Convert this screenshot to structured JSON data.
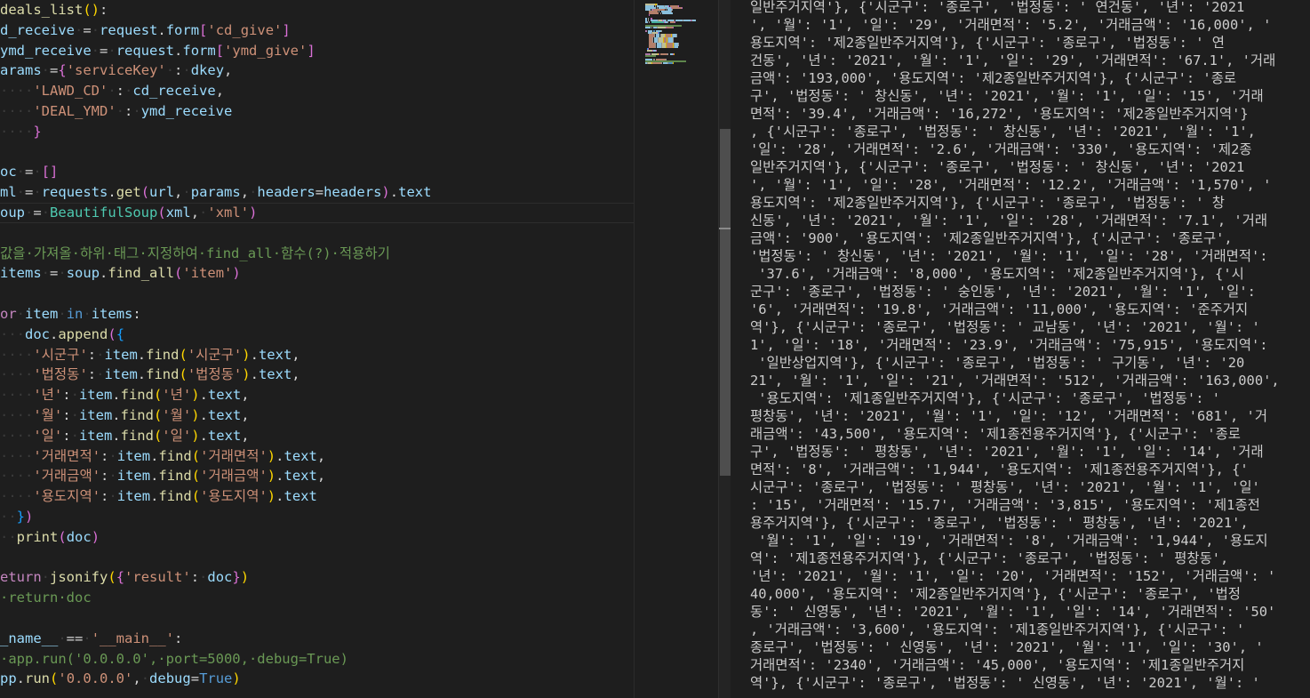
{
  "editor": {
    "lines": [
      [
        [
          "fn",
          "deals_list"
        ],
        [
          "br1",
          "("
        ],
        [
          "br1",
          ")"
        ],
        [
          "p",
          ":"
        ]
      ],
      [
        [
          "var",
          "d_receive"
        ],
        [
          "ws",
          "·"
        ],
        [
          "op",
          "="
        ],
        [
          "ws",
          "·"
        ],
        [
          "var",
          "request"
        ],
        [
          "p",
          "."
        ],
        [
          "var",
          "form"
        ],
        [
          "br2",
          "["
        ],
        [
          "str",
          "'cd_give'"
        ],
        [
          "br2",
          "]"
        ]
      ],
      [
        [
          "var",
          "ymd_receive"
        ],
        [
          "ws",
          "·"
        ],
        [
          "op",
          "="
        ],
        [
          "ws",
          "·"
        ],
        [
          "var",
          "request"
        ],
        [
          "p",
          "."
        ],
        [
          "var",
          "form"
        ],
        [
          "br2",
          "["
        ],
        [
          "str",
          "'ymd_give'"
        ],
        [
          "br2",
          "]"
        ]
      ],
      [
        [
          "var",
          "arams"
        ],
        [
          "ws",
          "·"
        ],
        [
          "op",
          "="
        ],
        [
          "br2",
          "{"
        ],
        [
          "str",
          "'serviceKey'"
        ],
        [
          "ws",
          "·"
        ],
        [
          "p",
          ":"
        ],
        [
          "ws",
          "·"
        ],
        [
          "var",
          "dkey"
        ],
        [
          "p",
          ","
        ]
      ],
      [
        [
          "ws",
          "····"
        ],
        [
          "str",
          "'LAWD_CD'"
        ],
        [
          "ws",
          "·"
        ],
        [
          "p",
          ":"
        ],
        [
          "ws",
          "·"
        ],
        [
          "var",
          "cd_receive"
        ],
        [
          "p",
          ","
        ]
      ],
      [
        [
          "ws",
          "····"
        ],
        [
          "str",
          "'DEAL_YMD'"
        ],
        [
          "ws",
          "·"
        ],
        [
          "p",
          ":"
        ],
        [
          "ws",
          "·"
        ],
        [
          "var",
          "ymd_receive"
        ]
      ],
      [
        [
          "ws",
          "····"
        ],
        [
          "br2",
          "}"
        ]
      ],
      [],
      [
        [
          "var",
          "oc"
        ],
        [
          "ws",
          "·"
        ],
        [
          "op",
          "="
        ],
        [
          "ws",
          "·"
        ],
        [
          "br2",
          "["
        ],
        [
          "br2",
          "]"
        ]
      ],
      [
        [
          "var",
          "ml"
        ],
        [
          "ws",
          "·"
        ],
        [
          "op",
          "="
        ],
        [
          "ws",
          "·"
        ],
        [
          "var",
          "requests"
        ],
        [
          "p",
          "."
        ],
        [
          "fn",
          "get"
        ],
        [
          "br2",
          "("
        ],
        [
          "var",
          "url"
        ],
        [
          "p",
          ","
        ],
        [
          "ws",
          "·"
        ],
        [
          "var",
          "params"
        ],
        [
          "p",
          ","
        ],
        [
          "ws",
          "·"
        ],
        [
          "var",
          "headers"
        ],
        [
          "op",
          "="
        ],
        [
          "var",
          "headers"
        ],
        [
          "br2",
          ")"
        ],
        [
          "p",
          "."
        ],
        [
          "var",
          "text"
        ]
      ],
      [
        [
          "var",
          "oup"
        ],
        [
          "ws",
          "·"
        ],
        [
          "op",
          "="
        ],
        [
          "ws",
          "·"
        ],
        [
          "cls",
          "BeautifulSoup"
        ],
        [
          "br2",
          "("
        ],
        [
          "var",
          "xml"
        ],
        [
          "p",
          ","
        ],
        [
          "ws",
          "·"
        ],
        [
          "str",
          "'xml'"
        ],
        [
          "br2",
          ")"
        ]
      ],
      [],
      [
        [
          "com",
          "값을·가져올·하위·태그·지정하여·find_all·함수(?)·적용하기"
        ]
      ],
      [
        [
          "var",
          "items"
        ],
        [
          "ws",
          "·"
        ],
        [
          "op",
          "="
        ],
        [
          "ws",
          "·"
        ],
        [
          "var",
          "soup"
        ],
        [
          "p",
          "."
        ],
        [
          "fn",
          "find_all"
        ],
        [
          "br2",
          "("
        ],
        [
          "str",
          "'item'"
        ],
        [
          "br2",
          ")"
        ]
      ],
      [],
      [
        [
          "kw",
          "or"
        ],
        [
          "ws",
          "·"
        ],
        [
          "var",
          "item"
        ],
        [
          "ws",
          "·"
        ],
        [
          "kwb",
          "in"
        ],
        [
          "ws",
          "·"
        ],
        [
          "var",
          "items"
        ],
        [
          "p",
          ":"
        ]
      ],
      [
        [
          "ws",
          "···"
        ],
        [
          "var",
          "doc"
        ],
        [
          "p",
          "."
        ],
        [
          "fn",
          "append"
        ],
        [
          "br2",
          "("
        ],
        [
          "br3",
          "{"
        ]
      ],
      [
        [
          "ws",
          "····"
        ],
        [
          "str",
          "'시군구'"
        ],
        [
          "p",
          ":"
        ],
        [
          "ws",
          "·"
        ],
        [
          "var",
          "item"
        ],
        [
          "p",
          "."
        ],
        [
          "fn",
          "find"
        ],
        [
          "br1",
          "("
        ],
        [
          "str",
          "'시군구'"
        ],
        [
          "br1",
          ")"
        ],
        [
          "p",
          "."
        ],
        [
          "var",
          "text"
        ],
        [
          "p",
          ","
        ]
      ],
      [
        [
          "ws",
          "····"
        ],
        [
          "str",
          "'법정동'"
        ],
        [
          "p",
          ":"
        ],
        [
          "ws",
          "·"
        ],
        [
          "var",
          "item"
        ],
        [
          "p",
          "."
        ],
        [
          "fn",
          "find"
        ],
        [
          "br1",
          "("
        ],
        [
          "str",
          "'법정동'"
        ],
        [
          "br1",
          ")"
        ],
        [
          "p",
          "."
        ],
        [
          "var",
          "text"
        ],
        [
          "p",
          ","
        ]
      ],
      [
        [
          "ws",
          "····"
        ],
        [
          "str",
          "'년'"
        ],
        [
          "p",
          ":"
        ],
        [
          "ws",
          "·"
        ],
        [
          "var",
          "item"
        ],
        [
          "p",
          "."
        ],
        [
          "fn",
          "find"
        ],
        [
          "br1",
          "("
        ],
        [
          "str",
          "'년'"
        ],
        [
          "br1",
          ")"
        ],
        [
          "p",
          "."
        ],
        [
          "var",
          "text"
        ],
        [
          "p",
          ","
        ]
      ],
      [
        [
          "ws",
          "····"
        ],
        [
          "str",
          "'월'"
        ],
        [
          "p",
          ":"
        ],
        [
          "ws",
          "·"
        ],
        [
          "var",
          "item"
        ],
        [
          "p",
          "."
        ],
        [
          "fn",
          "find"
        ],
        [
          "br1",
          "("
        ],
        [
          "str",
          "'월'"
        ],
        [
          "br1",
          ")"
        ],
        [
          "p",
          "."
        ],
        [
          "var",
          "text"
        ],
        [
          "p",
          ","
        ]
      ],
      [
        [
          "ws",
          "····"
        ],
        [
          "str",
          "'일'"
        ],
        [
          "p",
          ":"
        ],
        [
          "ws",
          "·"
        ],
        [
          "var",
          "item"
        ],
        [
          "p",
          "."
        ],
        [
          "fn",
          "find"
        ],
        [
          "br1",
          "("
        ],
        [
          "str",
          "'일'"
        ],
        [
          "br1",
          ")"
        ],
        [
          "p",
          "."
        ],
        [
          "var",
          "text"
        ],
        [
          "p",
          ","
        ]
      ],
      [
        [
          "ws",
          "····"
        ],
        [
          "str",
          "'거래면적'"
        ],
        [
          "p",
          ":"
        ],
        [
          "ws",
          "·"
        ],
        [
          "var",
          "item"
        ],
        [
          "p",
          "."
        ],
        [
          "fn",
          "find"
        ],
        [
          "br1",
          "("
        ],
        [
          "str",
          "'거래면적'"
        ],
        [
          "br1",
          ")"
        ],
        [
          "p",
          "."
        ],
        [
          "var",
          "text"
        ],
        [
          "p",
          ","
        ]
      ],
      [
        [
          "ws",
          "····"
        ],
        [
          "str",
          "'거래금액'"
        ],
        [
          "p",
          ":"
        ],
        [
          "ws",
          "·"
        ],
        [
          "var",
          "item"
        ],
        [
          "p",
          "."
        ],
        [
          "fn",
          "find"
        ],
        [
          "br1",
          "("
        ],
        [
          "str",
          "'거래금액'"
        ],
        [
          "br1",
          ")"
        ],
        [
          "p",
          "."
        ],
        [
          "var",
          "text"
        ],
        [
          "p",
          ","
        ]
      ],
      [
        [
          "ws",
          "····"
        ],
        [
          "str",
          "'용도지역'"
        ],
        [
          "p",
          ":"
        ],
        [
          "ws",
          "·"
        ],
        [
          "var",
          "item"
        ],
        [
          "p",
          "."
        ],
        [
          "fn",
          "find"
        ],
        [
          "br1",
          "("
        ],
        [
          "str",
          "'용도지역'"
        ],
        [
          "br1",
          ")"
        ],
        [
          "p",
          "."
        ],
        [
          "var",
          "text"
        ]
      ],
      [
        [
          "ws",
          "··"
        ],
        [
          "br3",
          "}"
        ],
        [
          "br2",
          ")"
        ]
      ],
      [
        [
          "ws",
          "··"
        ],
        [
          "fn",
          "print"
        ],
        [
          "br2",
          "("
        ],
        [
          "var",
          "doc"
        ],
        [
          "br2",
          ")"
        ]
      ],
      [],
      [
        [
          "kw",
          "eturn"
        ],
        [
          "ws",
          "·"
        ],
        [
          "fn",
          "jsonify"
        ],
        [
          "br1",
          "("
        ],
        [
          "br2",
          "{"
        ],
        [
          "str",
          "'result'"
        ],
        [
          "p",
          ":"
        ],
        [
          "ws",
          "·"
        ],
        [
          "var",
          "doc"
        ],
        [
          "br2",
          "}"
        ],
        [
          "br1",
          ")"
        ]
      ],
      [
        [
          "com",
          "·return·doc"
        ]
      ],
      [],
      [
        [
          "var",
          "_name__"
        ],
        [
          "ws",
          "·"
        ],
        [
          "op",
          "=="
        ],
        [
          "ws",
          "·"
        ],
        [
          "str",
          "'__main__'"
        ],
        [
          "p",
          ":"
        ]
      ],
      [
        [
          "com",
          "·app.run('0.0.0.0',·port=5000,·debug=True)"
        ]
      ],
      [
        [
          "var",
          "pp"
        ],
        [
          "p",
          "."
        ],
        [
          "fn",
          "run"
        ],
        [
          "br1",
          "("
        ],
        [
          "str",
          "'0.0.0.0'"
        ],
        [
          "p",
          ","
        ],
        [
          "ws",
          "·"
        ],
        [
          "var",
          "debug"
        ],
        [
          "op",
          "="
        ],
        [
          "kwb",
          "True"
        ],
        [
          "br1",
          ")"
        ]
      ]
    ]
  },
  "output": {
    "lines": [
      "일반주거지역'}, {'시군구': '종로구', '법정동': ' 연건동', '년': '2021",
      "', '월': '1', '일': '29', '거래면적': '5.2', '거래금액': '16,000', '",
      "용도지역': '제2종일반주거지역'}, {'시군구': '종로구', '법정동': ' 연",
      "건동', '년': '2021', '월': '1', '일': '29', '거래면적': '67.1', '거래",
      "금액': '193,000', '용도지역': '제2종일반주거지역'}, {'시군구': '종로",
      "구', '법정동': ' 창신동', '년': '2021', '월': '1', '일': '15', '거래",
      "면적': '39.4', '거래금액': '16,272', '용도지역': '제2종일반주거지역'}",
      ", {'시군구': '종로구', '법정동': ' 창신동', '년': '2021', '월': '1',",
      "'일': '28', '거래면적': '2.6', '거래금액': '330', '용도지역': '제2종",
      "일반주거지역'}, {'시군구': '종로구', '법정동': ' 창신동', '년': '2021",
      "', '월': '1', '일': '28', '거래면적': '12.2', '거래금액': '1,570', '",
      "용도지역': '제2종일반주거지역'}, {'시군구': '종로구', '법정동': ' 창",
      "신동', '년': '2021', '월': '1', '일': '28', '거래면적': '7.1', '거래",
      "금액': '900', '용도지역': '제2종일반주거지역'}, {'시군구': '종로구',",
      "'법정동': ' 창신동', '년': '2021', '월': '1', '일': '28', '거래면적':",
      " '37.6', '거래금액': '8,000', '용도지역': '제2종일반주거지역'}, {'시",
      "군구': '종로구', '법정동': ' 숭인동', '년': '2021', '월': '1', '일':",
      "'6', '거래면적': '19.8', '거래금액': '11,000', '용도지역': '준주거지",
      "역'}, {'시군구': '종로구', '법정동': ' 교남동', '년': '2021', '월': '",
      "1', '일': '18', '거래면적': '23.9', '거래금액': '75,915', '용도지역':",
      " '일반상업지역'}, {'시군구': '종로구', '법정동': ' 구기동', '년': '20",
      "21', '월': '1', '일': '21', '거래면적': '512', '거래금액': '163,000',",
      " '용도지역': '제1종일반주거지역'}, {'시군구': '종로구', '법정동': '",
      "평창동', '년': '2021', '월': '1', '일': '12', '거래면적': '681', '거",
      "래금액': '43,500', '용도지역': '제1종전용주거지역'}, {'시군구': '종로",
      "구', '법정동': ' 평창동', '년': '2021', '월': '1', '일': '14', '거래",
      "면적': '8', '거래금액': '1,944', '용도지역': '제1종전용주거지역'}, {'",
      "시군구': '종로구', '법정동': ' 평창동', '년': '2021', '월': '1', '일'",
      ": '15', '거래면적': '15.7', '거래금액': '3,815', '용도지역': '제1종전",
      "용주거지역'}, {'시군구': '종로구', '법정동': ' 평창동', '년': '2021',",
      " '월': '1', '일': '19', '거래면적': '8', '거래금액': '1,944', '용도지",
      "역': '제1종전용주거지역'}, {'시군구': '종로구', '법정동': ' 평창동',",
      "'년': '2021', '월': '1', '일': '20', '거래면적': '152', '거래금액': '",
      "40,000', '용도지역': '제2종일반주거지역'}, {'시군구': '종로구', '법정",
      "동': ' 신영동', '년': '2021', '월': '1', '일': '14', '거래면적': '50'",
      ", '거래금액': '3,600', '용도지역': '제1종일반주거지역'}, {'시군구': '",
      "종로구', '법정동': ' 신영동', '년': '2021', '월': '1', '일': '30', '",
      "거래면적': '2340', '거래금액': '45,000', '용도지역': '제1종일반주거지",
      "역'}, {'시군구': '종로구', '법정동': ' 신영동', '년': '2021', '월': '"
    ]
  },
  "colors": {
    "background": "#1e1e1e",
    "function": "#dcdcaa",
    "variable": "#9cdcfe",
    "string": "#ce9178",
    "keyword": "#c586c0",
    "comment": "#6a9955"
  }
}
